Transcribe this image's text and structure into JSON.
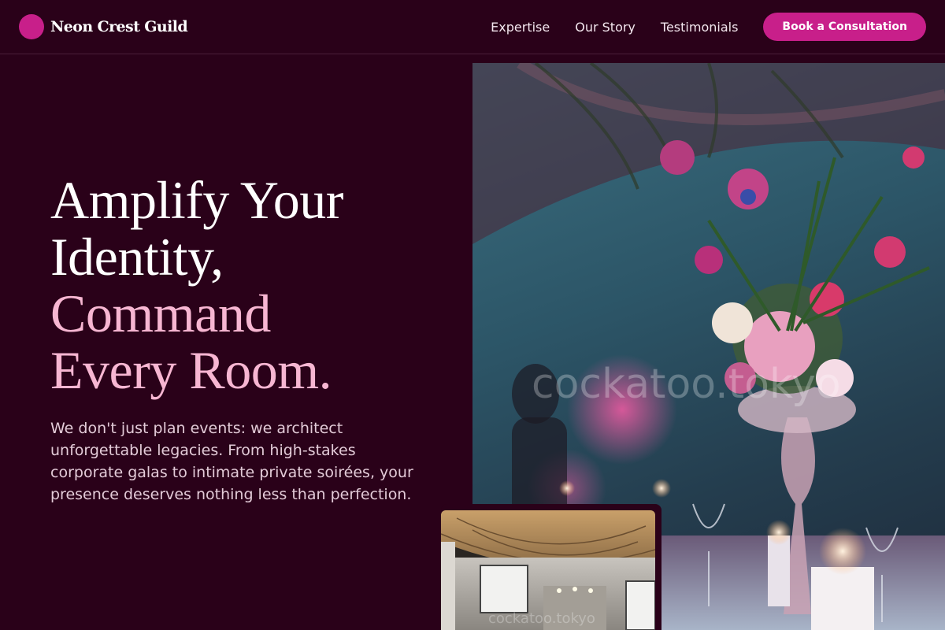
{
  "brand": {
    "name": "Neon Crest Guild",
    "accent": "#c81f8a"
  },
  "nav": {
    "links": [
      {
        "label": "Expertise"
      },
      {
        "label": "Our Story"
      },
      {
        "label": "Testimonials"
      }
    ],
    "cta_label": "Book a Consultation"
  },
  "hero": {
    "headline_line1": "Amplify Your",
    "headline_line2": "Identity,",
    "headline_line3": "Command",
    "headline_line4": "Every Room.",
    "subtext": "We don't just plan events: we architect unforgettable legacies. From high-stakes corporate galas to intimate private soirées, your presence deserves nothing less than perfection."
  },
  "images": {
    "main_watermark": "cockatoo.tokyo",
    "inset_watermark": "cockatoo.tokyo"
  },
  "colors": {
    "background": "#2a0119",
    "headline_accent": "#f7b6d2",
    "button": "#c81f8a"
  }
}
